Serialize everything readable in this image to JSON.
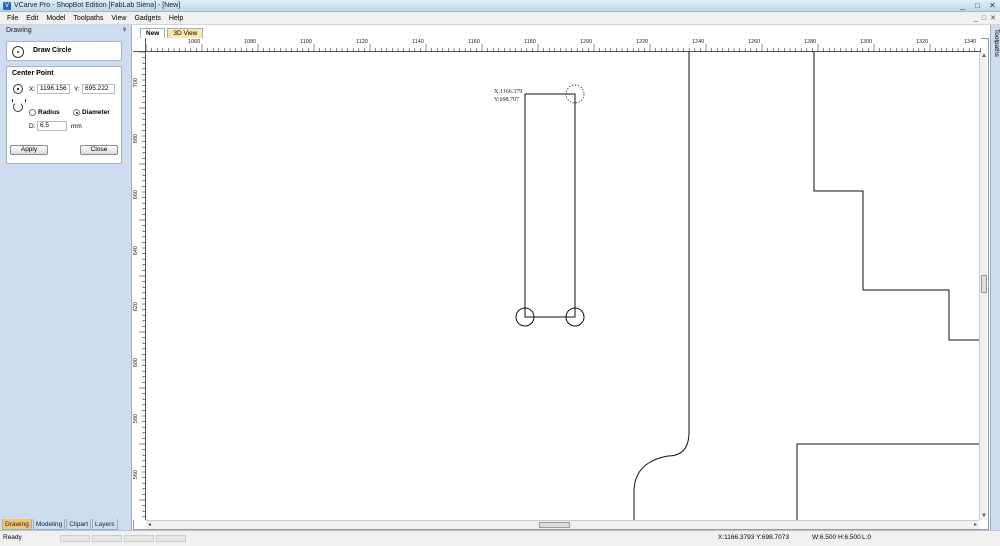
{
  "window": {
    "title": "VCarve Pro - ShopBot Edition [FabLab Siena] - [New]",
    "controls": [
      "_",
      "□",
      "✕"
    ]
  },
  "menu": {
    "items": [
      "File",
      "Edit",
      "Model",
      "Toolpaths",
      "View",
      "Gadgets",
      "Help"
    ],
    "mdi_controls": [
      "_",
      "□",
      "✕"
    ]
  },
  "panel": {
    "title": "Drawing",
    "pin": "ᵠ",
    "tool_title": "Draw Circle",
    "center_point": {
      "heading": "Center Point",
      "x_label": "X:",
      "x_value": "1196.156",
      "y_label": "Y:",
      "y_value": "695.222"
    },
    "size": {
      "radius_label": "Radius",
      "diameter_label": "Diameter",
      "selected": "Diameter",
      "d_label": "D:",
      "d_value": "6.5",
      "unit": "mm"
    },
    "apply_label": "Apply",
    "close_label": "Close",
    "bottom_tabs": [
      "Drawing",
      "Modeling",
      "Clipart",
      "Layers"
    ],
    "active_bottom_tab": "Drawing"
  },
  "doc_tabs": [
    "New",
    "3D View"
  ],
  "right_tab": "Toolpaths",
  "ruler": {
    "top_labels": [
      "1060",
      "1080",
      "1100",
      "1120",
      "1140",
      "1160",
      "1180",
      "1200",
      "1220",
      "1240",
      "1260",
      "1280",
      "1300",
      "1320",
      "1340"
    ],
    "left_labels": [
      "700",
      "680",
      "660",
      "640",
      "620",
      "600",
      "580",
      "560"
    ]
  },
  "canvas": {
    "cursor_x": "X:1166.379",
    "cursor_y": "Y:698.707"
  },
  "status": {
    "ready": "Ready",
    "coords": "X:1166.3793 Y:698.7073",
    "w": "W:6.500",
    "h": "H:6.500",
    "l": "L:0"
  },
  "colors": {
    "panel_bg": "#cddcee",
    "active_tab": "#f7c36a",
    "view3d_tab": "#f9e6a8"
  }
}
